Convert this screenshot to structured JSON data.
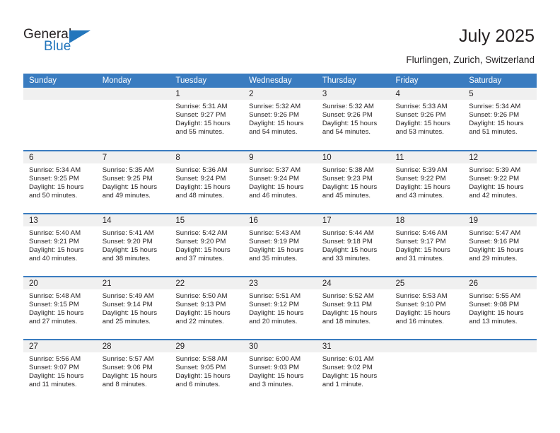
{
  "brand": {
    "name_part1": "General",
    "name_part2": "Blue",
    "triangle_color": "#2376bc"
  },
  "header": {
    "title": "July 2025",
    "subtitle": "Flurlingen, Zurich, Switzerland"
  },
  "theme": {
    "header_blue": "#3a7cc0",
    "daynum_band": "#f0f0f0",
    "text": "#231f20"
  },
  "calendar": {
    "weekday_headers": [
      "Sunday",
      "Monday",
      "Tuesday",
      "Wednesday",
      "Thursday",
      "Friday",
      "Saturday"
    ],
    "weeks": [
      [
        {
          "day": "",
          "sunrise": "",
          "sunset": "",
          "daylight1": "",
          "daylight2": "",
          "empty": true
        },
        {
          "day": "",
          "sunrise": "",
          "sunset": "",
          "daylight1": "",
          "daylight2": "",
          "empty": true
        },
        {
          "day": "1",
          "sunrise": "Sunrise: 5:31 AM",
          "sunset": "Sunset: 9:27 PM",
          "daylight1": "Daylight: 15 hours",
          "daylight2": "and 55 minutes."
        },
        {
          "day": "2",
          "sunrise": "Sunrise: 5:32 AM",
          "sunset": "Sunset: 9:26 PM",
          "daylight1": "Daylight: 15 hours",
          "daylight2": "and 54 minutes."
        },
        {
          "day": "3",
          "sunrise": "Sunrise: 5:32 AM",
          "sunset": "Sunset: 9:26 PM",
          "daylight1": "Daylight: 15 hours",
          "daylight2": "and 54 minutes."
        },
        {
          "day": "4",
          "sunrise": "Sunrise: 5:33 AM",
          "sunset": "Sunset: 9:26 PM",
          "daylight1": "Daylight: 15 hours",
          "daylight2": "and 53 minutes."
        },
        {
          "day": "5",
          "sunrise": "Sunrise: 5:34 AM",
          "sunset": "Sunset: 9:26 PM",
          "daylight1": "Daylight: 15 hours",
          "daylight2": "and 51 minutes."
        }
      ],
      [
        {
          "day": "6",
          "sunrise": "Sunrise: 5:34 AM",
          "sunset": "Sunset: 9:25 PM",
          "daylight1": "Daylight: 15 hours",
          "daylight2": "and 50 minutes."
        },
        {
          "day": "7",
          "sunrise": "Sunrise: 5:35 AM",
          "sunset": "Sunset: 9:25 PM",
          "daylight1": "Daylight: 15 hours",
          "daylight2": "and 49 minutes."
        },
        {
          "day": "8",
          "sunrise": "Sunrise: 5:36 AM",
          "sunset": "Sunset: 9:24 PM",
          "daylight1": "Daylight: 15 hours",
          "daylight2": "and 48 minutes."
        },
        {
          "day": "9",
          "sunrise": "Sunrise: 5:37 AM",
          "sunset": "Sunset: 9:24 PM",
          "daylight1": "Daylight: 15 hours",
          "daylight2": "and 46 minutes."
        },
        {
          "day": "10",
          "sunrise": "Sunrise: 5:38 AM",
          "sunset": "Sunset: 9:23 PM",
          "daylight1": "Daylight: 15 hours",
          "daylight2": "and 45 minutes."
        },
        {
          "day": "11",
          "sunrise": "Sunrise: 5:39 AM",
          "sunset": "Sunset: 9:22 PM",
          "daylight1": "Daylight: 15 hours",
          "daylight2": "and 43 minutes."
        },
        {
          "day": "12",
          "sunrise": "Sunrise: 5:39 AM",
          "sunset": "Sunset: 9:22 PM",
          "daylight1": "Daylight: 15 hours",
          "daylight2": "and 42 minutes."
        }
      ],
      [
        {
          "day": "13",
          "sunrise": "Sunrise: 5:40 AM",
          "sunset": "Sunset: 9:21 PM",
          "daylight1": "Daylight: 15 hours",
          "daylight2": "and 40 minutes."
        },
        {
          "day": "14",
          "sunrise": "Sunrise: 5:41 AM",
          "sunset": "Sunset: 9:20 PM",
          "daylight1": "Daylight: 15 hours",
          "daylight2": "and 38 minutes."
        },
        {
          "day": "15",
          "sunrise": "Sunrise: 5:42 AM",
          "sunset": "Sunset: 9:20 PM",
          "daylight1": "Daylight: 15 hours",
          "daylight2": "and 37 minutes."
        },
        {
          "day": "16",
          "sunrise": "Sunrise: 5:43 AM",
          "sunset": "Sunset: 9:19 PM",
          "daylight1": "Daylight: 15 hours",
          "daylight2": "and 35 minutes."
        },
        {
          "day": "17",
          "sunrise": "Sunrise: 5:44 AM",
          "sunset": "Sunset: 9:18 PM",
          "daylight1": "Daylight: 15 hours",
          "daylight2": "and 33 minutes."
        },
        {
          "day": "18",
          "sunrise": "Sunrise: 5:46 AM",
          "sunset": "Sunset: 9:17 PM",
          "daylight1": "Daylight: 15 hours",
          "daylight2": "and 31 minutes."
        },
        {
          "day": "19",
          "sunrise": "Sunrise: 5:47 AM",
          "sunset": "Sunset: 9:16 PM",
          "daylight1": "Daylight: 15 hours",
          "daylight2": "and 29 minutes."
        }
      ],
      [
        {
          "day": "20",
          "sunrise": "Sunrise: 5:48 AM",
          "sunset": "Sunset: 9:15 PM",
          "daylight1": "Daylight: 15 hours",
          "daylight2": "and 27 minutes."
        },
        {
          "day": "21",
          "sunrise": "Sunrise: 5:49 AM",
          "sunset": "Sunset: 9:14 PM",
          "daylight1": "Daylight: 15 hours",
          "daylight2": "and 25 minutes."
        },
        {
          "day": "22",
          "sunrise": "Sunrise: 5:50 AM",
          "sunset": "Sunset: 9:13 PM",
          "daylight1": "Daylight: 15 hours",
          "daylight2": "and 22 minutes."
        },
        {
          "day": "23",
          "sunrise": "Sunrise: 5:51 AM",
          "sunset": "Sunset: 9:12 PM",
          "daylight1": "Daylight: 15 hours",
          "daylight2": "and 20 minutes."
        },
        {
          "day": "24",
          "sunrise": "Sunrise: 5:52 AM",
          "sunset": "Sunset: 9:11 PM",
          "daylight1": "Daylight: 15 hours",
          "daylight2": "and 18 minutes."
        },
        {
          "day": "25",
          "sunrise": "Sunrise: 5:53 AM",
          "sunset": "Sunset: 9:10 PM",
          "daylight1": "Daylight: 15 hours",
          "daylight2": "and 16 minutes."
        },
        {
          "day": "26",
          "sunrise": "Sunrise: 5:55 AM",
          "sunset": "Sunset: 9:08 PM",
          "daylight1": "Daylight: 15 hours",
          "daylight2": "and 13 minutes."
        }
      ],
      [
        {
          "day": "27",
          "sunrise": "Sunrise: 5:56 AM",
          "sunset": "Sunset: 9:07 PM",
          "daylight1": "Daylight: 15 hours",
          "daylight2": "and 11 minutes."
        },
        {
          "day": "28",
          "sunrise": "Sunrise: 5:57 AM",
          "sunset": "Sunset: 9:06 PM",
          "daylight1": "Daylight: 15 hours",
          "daylight2": "and 8 minutes."
        },
        {
          "day": "29",
          "sunrise": "Sunrise: 5:58 AM",
          "sunset": "Sunset: 9:05 PM",
          "daylight1": "Daylight: 15 hours",
          "daylight2": "and 6 minutes."
        },
        {
          "day": "30",
          "sunrise": "Sunrise: 6:00 AM",
          "sunset": "Sunset: 9:03 PM",
          "daylight1": "Daylight: 15 hours",
          "daylight2": "and 3 minutes."
        },
        {
          "day": "31",
          "sunrise": "Sunrise: 6:01 AM",
          "sunset": "Sunset: 9:02 PM",
          "daylight1": "Daylight: 15 hours",
          "daylight2": "and 1 minute."
        },
        {
          "day": "",
          "sunrise": "",
          "sunset": "",
          "daylight1": "",
          "daylight2": "",
          "empty": true
        },
        {
          "day": "",
          "sunrise": "",
          "sunset": "",
          "daylight1": "",
          "daylight2": "",
          "empty": true
        }
      ]
    ]
  }
}
